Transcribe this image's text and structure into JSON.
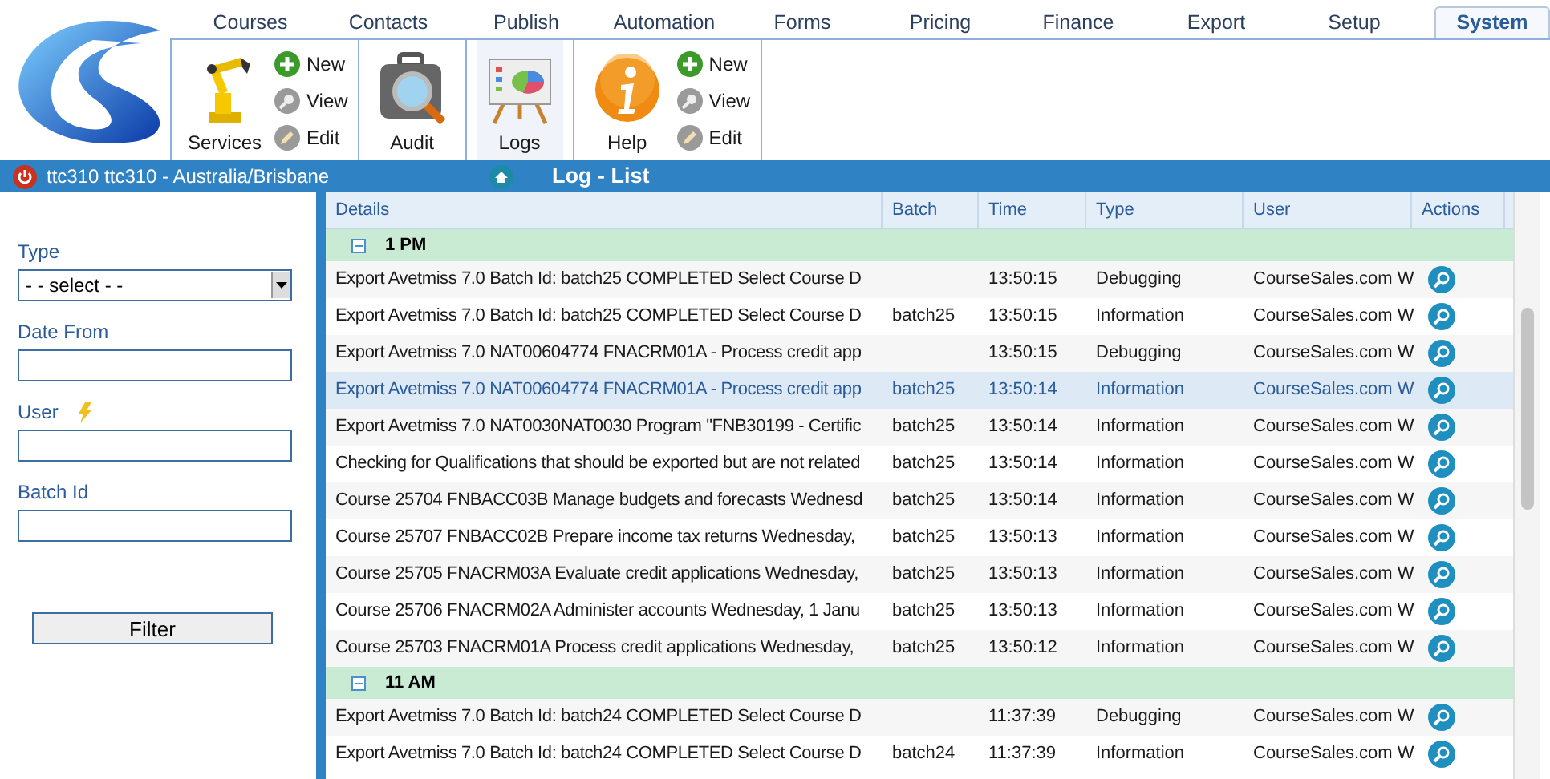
{
  "tabs": [
    {
      "label": "Courses",
      "selected": false
    },
    {
      "label": "Contacts",
      "selected": false
    },
    {
      "label": "Publish",
      "selected": false
    },
    {
      "label": "Automation",
      "selected": false
    },
    {
      "label": "Forms",
      "selected": false
    },
    {
      "label": "Pricing",
      "selected": false
    },
    {
      "label": "Finance",
      "selected": false
    },
    {
      "label": "Export",
      "selected": false
    },
    {
      "label": "Setup",
      "selected": false
    },
    {
      "label": "System",
      "selected": true
    }
  ],
  "toolbar": [
    {
      "kind": "robot",
      "label": "Services",
      "selected": false,
      "actions": [
        {
          "kind": "new",
          "label": "New"
        },
        {
          "kind": "view",
          "label": "View"
        },
        {
          "kind": "edit",
          "label": "Edit"
        }
      ]
    },
    {
      "kind": "audit",
      "label": "Audit",
      "selected": false
    },
    {
      "kind": "logs",
      "label": "Logs",
      "selected": true
    },
    {
      "kind": "help",
      "label": "Help",
      "selected": false,
      "actions": [
        {
          "kind": "new",
          "label": "New"
        },
        {
          "kind": "view",
          "label": "View"
        },
        {
          "kind": "edit",
          "label": "Edit"
        }
      ]
    }
  ],
  "status_bar": {
    "user": "ttc310 ttc310 - Australia/Brisbane",
    "title": "Log - List"
  },
  "filters": {
    "fields": [
      {
        "kind": "select",
        "label": "Type",
        "value": "- - select - -"
      },
      {
        "kind": "text",
        "label": "Date From"
      },
      {
        "kind": "user",
        "label": "User"
      },
      {
        "kind": "text",
        "label": "Batch Id"
      }
    ],
    "button": "Filter"
  },
  "table": {
    "columns": [
      "Details",
      "Batch",
      "Time",
      "Type",
      "User",
      "Actions"
    ],
    "groups": [
      {
        "label": "1 PM",
        "expanded": true,
        "rows": [
          {
            "details": "Export Avetmiss 7.0 Batch Id: batch25 COMPLETED Select Course D",
            "time": "13:50:15",
            "type": "Debugging",
            "user": "CourseSales.com W",
            "selected": false
          },
          {
            "details": "Export Avetmiss 7.0 Batch Id: batch25 COMPLETED Select Course D",
            "batch": "batch25",
            "time": "13:50:15",
            "type": "Information",
            "user": "CourseSales.com W",
            "selected": false
          },
          {
            "details": "Export Avetmiss 7.0 NAT00604774 FNACRM01A - Process credit app",
            "time": "13:50:15",
            "type": "Debugging",
            "user": "CourseSales.com W",
            "selected": false
          },
          {
            "details": "Export Avetmiss 7.0 NAT00604774 FNACRM01A - Process credit app",
            "batch": "batch25",
            "time": "13:50:14",
            "type": "Information",
            "user": "CourseSales.com W",
            "selected": true
          },
          {
            "details": "Export Avetmiss 7.0 NAT0030NAT0030 Program \"FNB30199 - Certific",
            "batch": "batch25",
            "time": "13:50:14",
            "type": "Information",
            "user": "CourseSales.com W",
            "selected": false
          },
          {
            "details": "Checking for Qualifications that should be exported but are not related",
            "batch": "batch25",
            "time": "13:50:14",
            "type": "Information",
            "user": "CourseSales.com W",
            "selected": false
          },
          {
            "details": "Course 25704 FNBACC03B Manage budgets and forecasts Wednesd",
            "batch": "batch25",
            "time": "13:50:14",
            "type": "Information",
            "user": "CourseSales.com W",
            "selected": false
          },
          {
            "details": "Course 25707 FNBACC02B Prepare income tax returns Wednesday,",
            "batch": "batch25",
            "time": "13:50:13",
            "type": "Information",
            "user": "CourseSales.com W",
            "selected": false
          },
          {
            "details": "Course 25705 FNACRM03A Evaluate credit applications Wednesday,",
            "batch": "batch25",
            "time": "13:50:13",
            "type": "Information",
            "user": "CourseSales.com W",
            "selected": false
          },
          {
            "details": "Course 25706 FNACRM02A Administer accounts Wednesday, 1 Janu",
            "batch": "batch25",
            "time": "13:50:13",
            "type": "Information",
            "user": "CourseSales.com W",
            "selected": false
          },
          {
            "details": "Course 25703 FNACRM01A Process credit applications Wednesday,",
            "batch": "batch25",
            "time": "13:50:12",
            "type": "Information",
            "user": "CourseSales.com W",
            "selected": false
          }
        ]
      },
      {
        "label": "11 AM",
        "expanded": true,
        "rows": [
          {
            "details": "Export Avetmiss 7.0 Batch Id: batch24 COMPLETED Select Course D",
            "time": "11:37:39",
            "type": "Debugging",
            "user": "CourseSales.com W",
            "selected": false
          },
          {
            "details": "Export Avetmiss 7.0 Batch Id: batch24 COMPLETED Select Course D",
            "batch": "batch24",
            "time": "11:37:39",
            "type": "Information",
            "user": "CourseSales.com W",
            "selected": false
          }
        ]
      }
    ]
  }
}
